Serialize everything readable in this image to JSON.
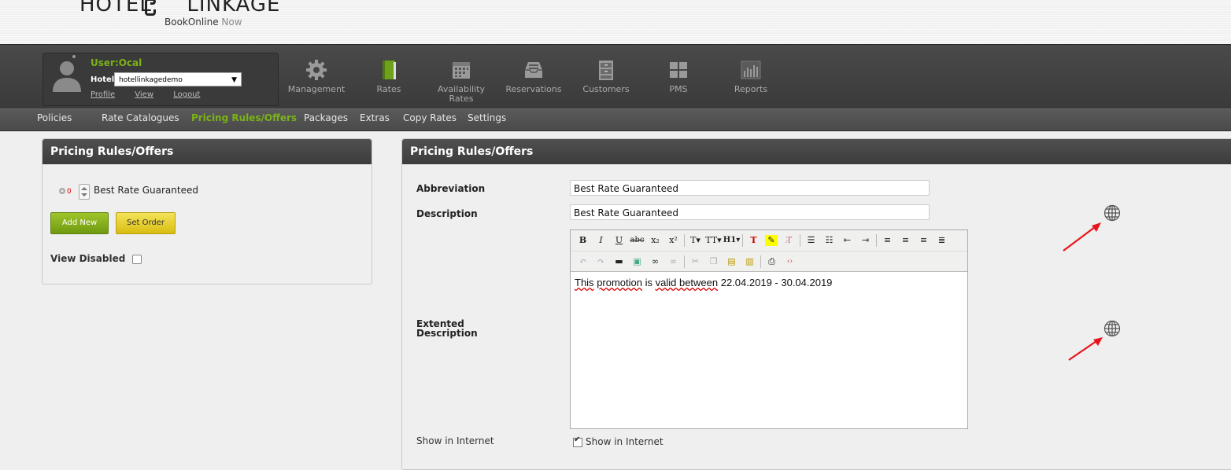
{
  "brand": {
    "name_left": "HOTEL",
    "name_right": "LINKAGE",
    "sub_main": "BookOnline",
    "sub_now": "Now"
  },
  "user": {
    "name": "User:Ocal",
    "hotel_label": "Hotel",
    "hotel_value": "hotellinkagedemo",
    "links": [
      "Profile",
      "View",
      "Logout"
    ]
  },
  "nav": [
    {
      "label": "Management",
      "icon": "gear-icon"
    },
    {
      "label": "Rates",
      "icon": "book-icon"
    },
    {
      "label": "Availability Rates",
      "icon": "calendar-icon"
    },
    {
      "label": "Reservations",
      "icon": "inbox-icon"
    },
    {
      "label": "Customers",
      "icon": "cabinet-icon"
    },
    {
      "label": "PMS",
      "icon": "grid-icon"
    },
    {
      "label": "Reports",
      "icon": "bar-chart-icon"
    }
  ],
  "submenu": [
    "Policies",
    "Rate Catalogues",
    "Pricing Rules/Offers",
    "Packages",
    "Extras",
    "Copy Rates",
    "Settings"
  ],
  "left_panel": {
    "title": "Pricing Rules/Offers",
    "item_count": "0",
    "item_name": "Best Rate Guaranteed",
    "add_new": "Add New",
    "set_order": "Set Order",
    "view_disabled": "View Disabled"
  },
  "right_panel": {
    "title": "Pricing Rules/Offers",
    "abbreviation_label": "Abbreviation",
    "abbreviation_value": "Best Rate Guaranteed",
    "description_label": "Description",
    "description_value": "Best Rate Guaranteed",
    "extended_label_1": "Extented",
    "extended_label_2": "Description",
    "editor_text_a": "This",
    "editor_text_b": "promotion",
    "editor_text_c": " is ",
    "editor_text_d": "valid between",
    "editor_text_e": " 22.04.2019 - 30.04.2019",
    "show_internet_label": "Show in Internet",
    "show_internet_check": "Show in Internet"
  },
  "colors": {
    "accent_green": "#7ab317",
    "annotation_red": "#e8141b"
  }
}
